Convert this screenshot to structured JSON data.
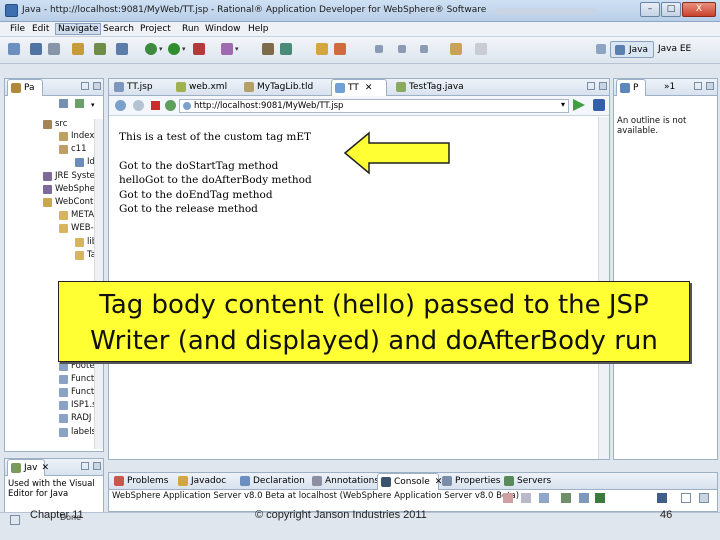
{
  "window": {
    "title": "Java - http://localhost:9081/MyWeb/TT.jsp - Rational® Application Developer for WebSphere® Software",
    "minimize": "–",
    "maximize": "□",
    "close": "X"
  },
  "menu": [
    "File",
    "Edit",
    "Navigate",
    "Search",
    "Project",
    "Run",
    "Window",
    "Help"
  ],
  "menu_selected": "Navigate",
  "perspectives": {
    "java": "Java",
    "java_ee": "Java EE"
  },
  "package_explorer": {
    "tab": "Pa",
    "tree": [
      "src",
      "Index",
      "c11",
      "Id",
      "JRE Syste",
      "WebSphe",
      "WebCont",
      "META",
      "WEB-",
      "lib",
      "Ta",
      "Foote",
      "Funct",
      "Funct",
      "ISP1.s",
      "RADJ",
      "labels"
    ]
  },
  "editor": {
    "tabs": [
      "TT.jsp",
      "web.xml",
      "MyTagLib.tld",
      "TT",
      "TestTag.java"
    ],
    "url": "http://localhost:9081/MyWeb/TT.jsp",
    "page_lines": [
      "This is a test of the custom tag mET",
      "Got to the doStartTag method",
      "helloGot to the doAfterBody method",
      "Got to the doEndTag method",
      "Got to the release method"
    ]
  },
  "outline": {
    "tab_p": "P",
    "tab_n": "»1",
    "message": "An outline is not available."
  },
  "javadoc_pane": {
    "tab": "Jav",
    "message": "Used with the Visual Editor for Java"
  },
  "bottom": {
    "tabs": [
      "Problems",
      "Javadoc",
      "Declaration",
      "Annotations",
      "Console",
      "Properties",
      "Servers"
    ],
    "status": "WebSphere Application Server v8.0 Beta at localhost (WebSphere Application Server v8.0 Beta)"
  },
  "statusbar": {
    "done": "Done"
  },
  "slide": {
    "callout": "Tag body content (hello) passed to the JSP Writer (and displayed) and doAfterBody run",
    "chapter": "Chapter 11",
    "copyright": "© copyright Janson Industries 2011",
    "page_number": "46"
  },
  "colors": {
    "callout_bg": "#ffff33",
    "arrow_fill": "#ffff33",
    "active_tab": "#ffffff"
  }
}
